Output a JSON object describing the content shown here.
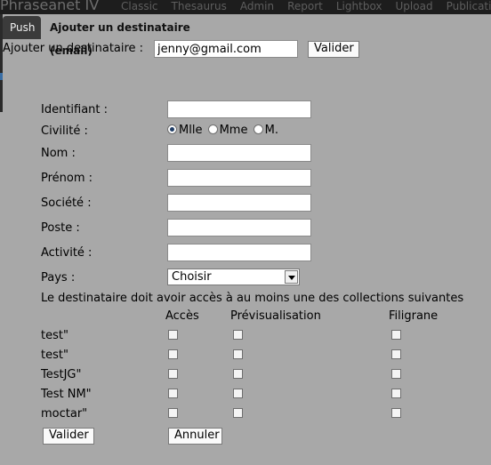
{
  "app": {
    "brand": "Phraseanet IV",
    "menu": [
      "Classic",
      "Thesaurus",
      "Admin",
      "Report",
      "Lightbox",
      "Upload",
      "Publications"
    ]
  },
  "tabs": [
    {
      "label": "Push"
    },
    {
      "label": "Ajouter un destinataire (email)"
    }
  ],
  "recipient": {
    "label": "Ajouter un destinataire :",
    "value": "jenny@gmail.com",
    "submit_label": "Valider"
  },
  "form": {
    "identifiant_label": "Identifiant :",
    "civilite_label": "Civilité :",
    "civilite_options": [
      "Mlle",
      "Mme",
      "M."
    ],
    "civilite_selected": "Mlle",
    "nom_label": "Nom :",
    "prenom_label": "Prénom :",
    "societe_label": "Société :",
    "poste_label": "Poste :",
    "activite_label": "Activité :",
    "pays_label": "Pays :",
    "pays_selected": "Choisir"
  },
  "collections": {
    "note": "Le destinataire doit avoir accès à au moins une des collections suivantes",
    "headers": {
      "acces": "Accès",
      "preview": "Prévisualisation",
      "watermark": "Filigrane"
    },
    "rows": [
      {
        "name": "test\""
      },
      {
        "name": "test\""
      },
      {
        "name": "TestJG\""
      },
      {
        "name": "Test NM\""
      },
      {
        "name": "moctar\""
      }
    ]
  },
  "actions": {
    "valider_label": "Valider",
    "annuler_label": "Annuler"
  }
}
